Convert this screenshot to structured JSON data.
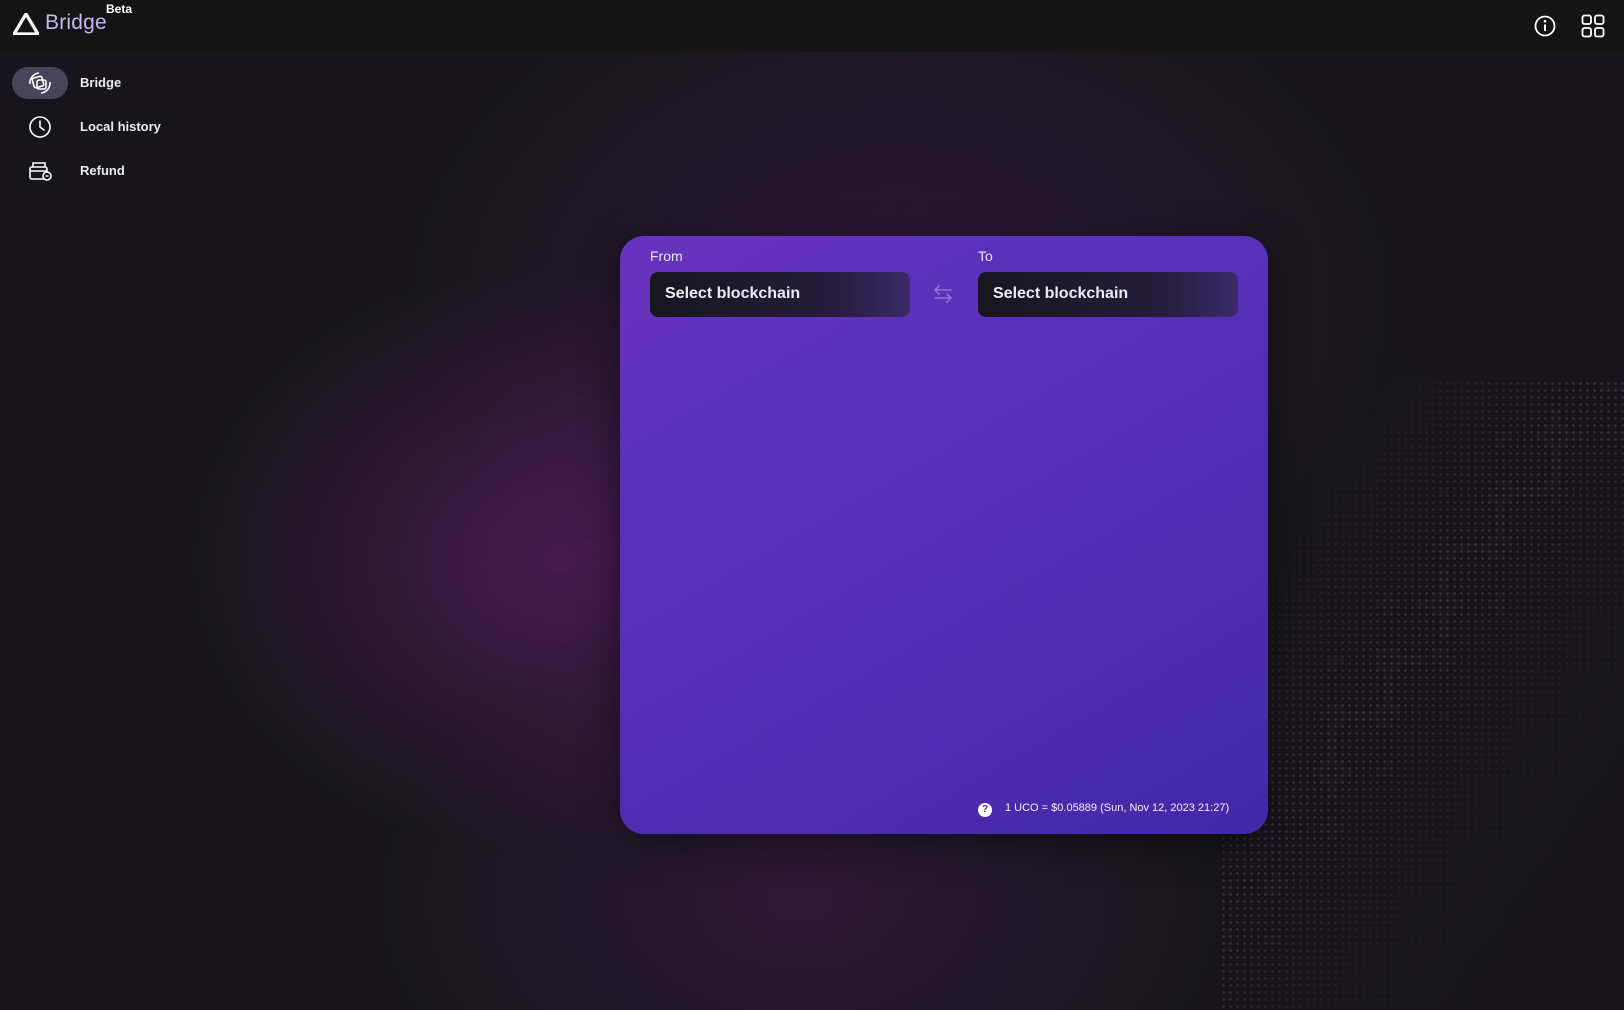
{
  "app": {
    "title": "Bridge",
    "badge": "Beta",
    "logo_icon": "triangle-logo-icon"
  },
  "header": {
    "info_icon": "info-icon",
    "apps_icon": "grid-icon"
  },
  "sidebar": {
    "items": [
      {
        "label": "Bridge",
        "icon": "bridge-icon",
        "active": true
      },
      {
        "label": "Local history",
        "icon": "clock-icon",
        "active": false
      },
      {
        "label": "Refund",
        "icon": "refund-icon",
        "active": false
      }
    ]
  },
  "bridge_form": {
    "from": {
      "label": "From",
      "placeholder": "Select blockchain"
    },
    "to": {
      "label": "To",
      "placeholder": "Select blockchain"
    },
    "swap_icon": "swap-arrows-icon",
    "price_info": "1 UCO = $0.05889 (Sun, Nov 12, 2023 21:27)",
    "help_icon": "question-icon",
    "help_glyph": "?"
  },
  "colors": {
    "accent": "#5a32c0",
    "active_nav": "#48455a",
    "background": "#141317"
  }
}
